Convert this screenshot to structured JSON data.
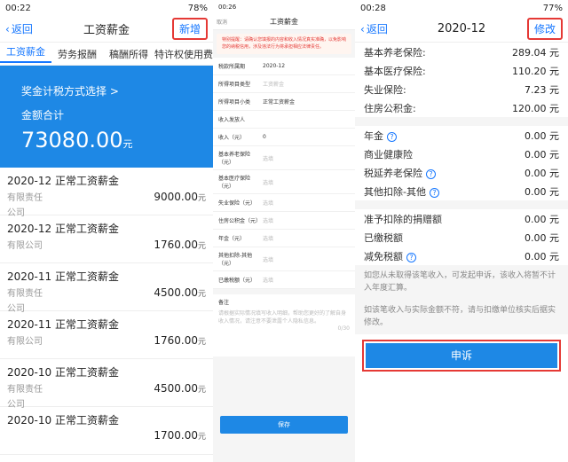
{
  "p1": {
    "status": {
      "time": "00:22",
      "battery": "78%"
    },
    "nav": {
      "back": "返回",
      "title": "工资薪金",
      "add": "新增"
    },
    "tabs": [
      "工资薪金",
      "劳务报酬",
      "稿酬所得",
      "特许权使用费"
    ],
    "hero": {
      "method": "奖金计税方式选择 >",
      "label": "金额合计",
      "amount": "73080.00",
      "unit": "元"
    },
    "records": [
      {
        "title": "2020-12 正常工资薪金",
        "company": "有限责任",
        "sub": "公司",
        "amount": "9000.00"
      },
      {
        "title": "2020-12 正常工资薪金",
        "company": "有限公司",
        "sub": "",
        "amount": "1760.00"
      },
      {
        "title": "2020-11 正常工资薪金",
        "company": "有限责任",
        "sub": "公司",
        "amount": "4500.00"
      },
      {
        "title": "2020-11 正常工资薪金",
        "company": "有限公司",
        "sub": "",
        "amount": "1760.00"
      },
      {
        "title": "2020-10 正常工资薪金",
        "company": "有限责任",
        "sub": "公司",
        "amount": "4500.00"
      },
      {
        "title": "2020-10 正常工资薪金",
        "company": "",
        "sub": "",
        "amount": "1700.00"
      }
    ],
    "unit": "元"
  },
  "p2": {
    "status": {
      "time": "00:26"
    },
    "nav": {
      "cancel": "取消",
      "title": "工资薪金"
    },
    "tip": "特别提醒：请确认您填报的内容和收入情况真实准确，以免影响您的纳税信用，涉及违法行为将承担相应法律责任。",
    "fields": [
      {
        "k": "税款所属期",
        "v": "2020-12",
        "ph": false
      },
      {
        "k": "所得项目类型",
        "v": "工资薪金",
        "ph": true
      },
      {
        "k": "所得项目小类",
        "v": "正常工资薪金",
        "ph": false
      },
      {
        "k": "收入发放人",
        "v": "",
        "ph": true
      },
      {
        "k": "收入（元）",
        "v": "0",
        "ph": false
      },
      {
        "k": "基本养老保险（元）",
        "v": "选填",
        "ph": true
      },
      {
        "k": "基本医疗保险（元）",
        "v": "选填",
        "ph": true
      },
      {
        "k": "失业保险（元）",
        "v": "选填",
        "ph": true
      },
      {
        "k": "住房公积金（元）",
        "v": "选填",
        "ph": true
      },
      {
        "k": "年金（元）",
        "v": "选填",
        "ph": true
      },
      {
        "k": "其他扣除-其他（元）",
        "v": "选填",
        "ph": true
      },
      {
        "k": "已缴税额（元）",
        "v": "选填",
        "ph": true
      }
    ],
    "remark": {
      "label": "备注",
      "placeholder": "请根据实际情况填写收入明细，帮助您更好的了解自身收入情况，请注意不要泄露个人隐私信息。",
      "count": "0/30"
    },
    "save": "保存"
  },
  "p3": {
    "status": {
      "time": "00:28",
      "battery": "77%"
    },
    "nav": {
      "back": "返回",
      "title": "2020-12",
      "edit": "修改"
    },
    "rows1": [
      {
        "k": "基本养老保险:",
        "v": "289.04 元"
      },
      {
        "k": "基本医疗保险:",
        "v": "110.20 元"
      },
      {
        "k": "失业保险:",
        "v": "7.23 元"
      },
      {
        "k": "住房公积金:",
        "v": "120.00 元"
      }
    ],
    "rows2": [
      {
        "k": "年金",
        "v": "0.00 元",
        "q": true
      },
      {
        "k": "商业健康险",
        "v": "0.00 元",
        "q": false
      },
      {
        "k": "税延养老保险",
        "v": "0.00 元",
        "q": true
      },
      {
        "k": "其他扣除-其他",
        "v": "0.00 元",
        "q": true
      }
    ],
    "rows3": [
      {
        "k": "准予扣除的捐赠额",
        "v": "0.00 元"
      },
      {
        "k": "已缴税额",
        "v": "0.00 元"
      },
      {
        "k": "减免税额",
        "v": "0.00 元",
        "q": true
      }
    ],
    "note1": "如您从未取得该笔收入，可发起申诉，该收入将暂不计入年度汇算。",
    "note2": "如该笔收入与实际金额不符，请与扣缴单位核实后据实修改。",
    "appeal": "申诉"
  }
}
